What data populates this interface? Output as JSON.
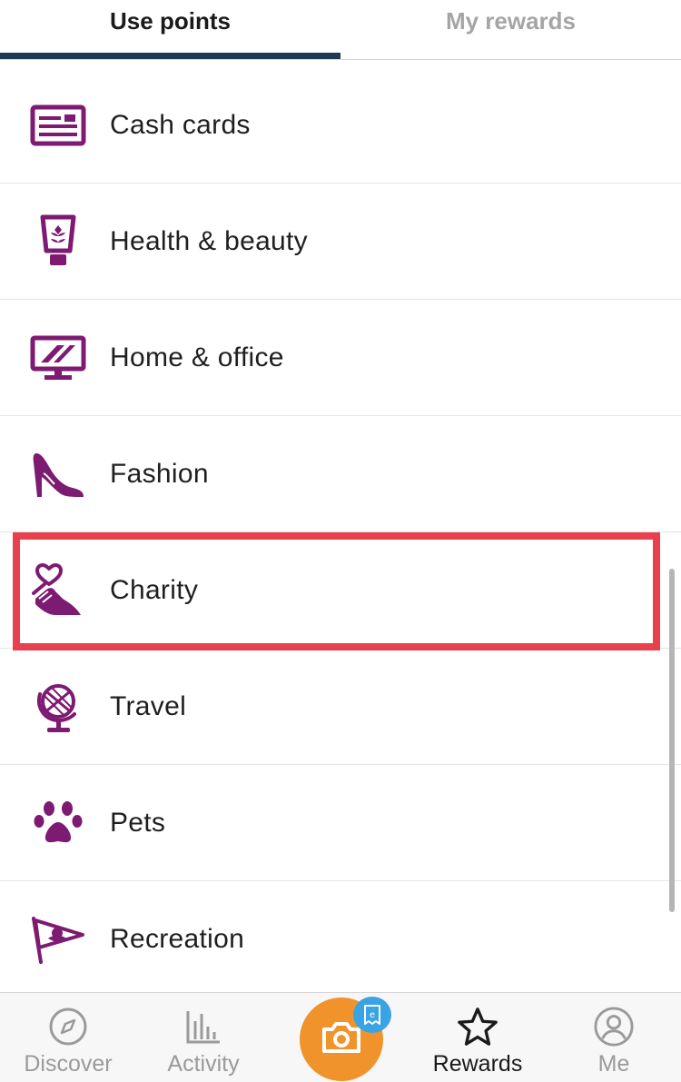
{
  "tabs": [
    {
      "label": "Use points",
      "active": true
    },
    {
      "label": "My rewards",
      "active": false
    }
  ],
  "categories": [
    {
      "label": "Cash cards",
      "icon": "cash-card-icon"
    },
    {
      "label": "Health & beauty",
      "icon": "beauty-tube-icon"
    },
    {
      "label": "Home & office",
      "icon": "monitor-icon"
    },
    {
      "label": "Fashion",
      "icon": "high-heel-icon"
    },
    {
      "label": "Charity",
      "icon": "heart-hand-icon",
      "highlighted": true
    },
    {
      "label": "Travel",
      "icon": "globe-icon"
    },
    {
      "label": "Pets",
      "icon": "paw-icon"
    },
    {
      "label": "Recreation",
      "icon": "pennant-flag-icon"
    }
  ],
  "bottom_nav": [
    {
      "label": "Discover",
      "icon": "compass-icon",
      "active": false
    },
    {
      "label": "Activity",
      "icon": "bar-chart-icon",
      "active": false
    },
    {
      "label": "",
      "icon": "camera-icon",
      "active": false
    },
    {
      "label": "Rewards",
      "icon": "star-icon",
      "active": true
    },
    {
      "label": "Me",
      "icon": "profile-icon",
      "active": false
    }
  ],
  "colors": {
    "icon_purple": "#7d1a72",
    "accent_orange": "#f0932b",
    "badge_blue": "#3aa3e3",
    "highlight_red": "#e8404d",
    "tab_underline": "#1e3a52"
  }
}
